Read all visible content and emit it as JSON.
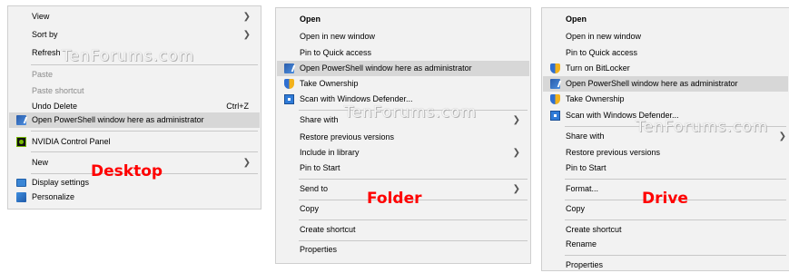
{
  "watermark": "TenForums.com",
  "labels": {
    "desktop": "Desktop",
    "folder": "Folder",
    "drive": "Drive"
  },
  "desktop_menu": {
    "view": "View",
    "sort_by": "Sort by",
    "refresh": "Refresh",
    "paste": "Paste",
    "paste_shortcut": "Paste shortcut",
    "undo_delete": "Undo Delete",
    "undo_shortcut": "Ctrl+Z",
    "open_powershell_admin": "Open PowerShell window here as administrator",
    "nvidia_control_panel": "NVIDIA Control Panel",
    "new": "New",
    "display_settings": "Display settings",
    "personalize": "Personalize"
  },
  "folder_menu": {
    "open": "Open",
    "open_new_window": "Open in new window",
    "pin_quick_access": "Pin to Quick access",
    "open_powershell_admin": "Open PowerShell window here as administrator",
    "take_ownership": "Take Ownership",
    "scan_defender": "Scan with Windows Defender...",
    "share_with": "Share with",
    "restore_previous": "Restore previous versions",
    "include_library": "Include in library",
    "pin_start": "Pin to Start",
    "send_to": "Send to",
    "copy": "Copy",
    "create_shortcut": "Create shortcut",
    "properties": "Properties"
  },
  "drive_menu": {
    "open": "Open",
    "open_new_window": "Open in new window",
    "pin_quick_access": "Pin to Quick access",
    "turn_on_bitlocker": "Turn on BitLocker",
    "open_powershell_admin": "Open PowerShell window here as administrator",
    "take_ownership": "Take Ownership",
    "scan_defender": "Scan with Windows Defender...",
    "share_with": "Share with",
    "restore_previous": "Restore previous versions",
    "pin_start": "Pin to Start",
    "format": "Format...",
    "copy": "Copy",
    "create_shortcut": "Create shortcut",
    "rename": "Rename",
    "properties": "Properties"
  },
  "icons": {
    "powershell": "powershell-icon",
    "shield": "uac-shield-icon",
    "defender": "windows-defender-icon",
    "nvidia": "nvidia-icon",
    "display": "display-settings-icon",
    "personalize": "personalize-icon",
    "arrow": "chevron-right-icon"
  },
  "colors": {
    "highlight": "#d7d7d7",
    "label_red": "#ff0000",
    "menu_bg": "#f2f2f2"
  }
}
